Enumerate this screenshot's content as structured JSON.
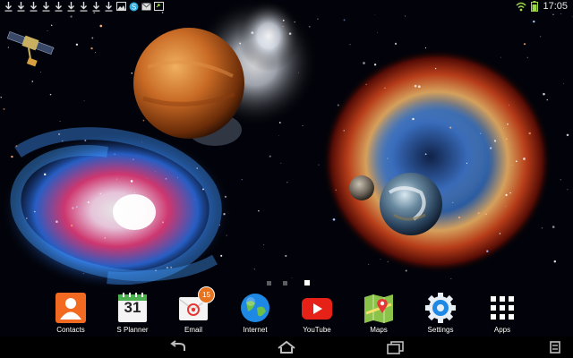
{
  "statusbar": {
    "time": "17:05",
    "left_icons": [
      "download-icon",
      "download-icon",
      "download-icon",
      "download-icon",
      "download-icon",
      "download-icon",
      "download-icon",
      "download-icon",
      "download-icon",
      "image-icon",
      "skype-icon",
      "email-icon",
      "screen-icon"
    ],
    "right_icons": [
      "wifi-icon",
      "battery-icon"
    ]
  },
  "wallpaper": {
    "elements": [
      "satellite",
      "spiral-galaxy",
      "orange-planet",
      "nebula-eye",
      "moon",
      "earth"
    ]
  },
  "page_indicator": {
    "count": 3,
    "active_index": 2
  },
  "dock": {
    "apps": [
      {
        "name": "contacts",
        "label": "Contacts",
        "color": "#f26a21"
      },
      {
        "name": "s-planner",
        "label": "S Planner",
        "day": "31",
        "color": "#4caf50"
      },
      {
        "name": "email",
        "label": "Email",
        "badge": "15",
        "color": "#e53935"
      },
      {
        "name": "internet",
        "label": "Internet",
        "color": "#1e88e5"
      },
      {
        "name": "youtube",
        "label": "YouTube",
        "color": "#e62117"
      },
      {
        "name": "maps",
        "label": "Maps",
        "color": "#4caf50"
      },
      {
        "name": "settings",
        "label": "Settings",
        "color": "#1e88e5"
      },
      {
        "name": "apps",
        "label": "Apps",
        "color": "#ffffff"
      }
    ]
  },
  "navbar": {
    "buttons": [
      "back-icon",
      "home-icon",
      "recent-apps-icon",
      "menu-icon"
    ]
  }
}
